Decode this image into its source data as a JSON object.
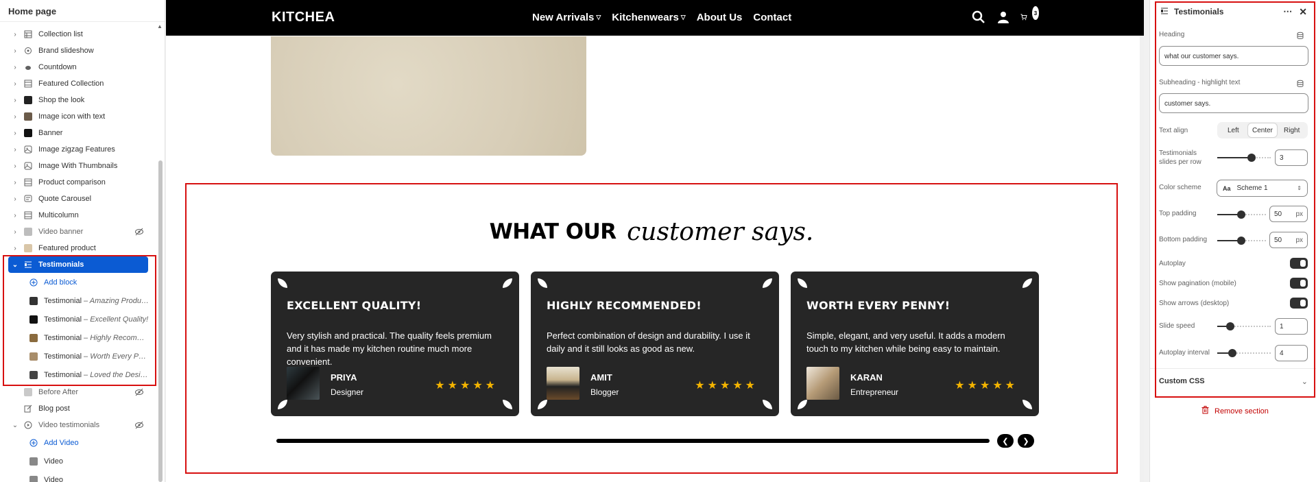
{
  "left_panel": {
    "title": "Home page",
    "items": [
      {
        "label": "Collection list",
        "icon": "grid-icon"
      },
      {
        "label": "Brand slideshow",
        "icon": "slideshow-icon"
      },
      {
        "label": "Countdown",
        "icon": "timer-icon"
      },
      {
        "label": "Featured Collection",
        "icon": "grid-icon"
      },
      {
        "label": "Shop the look",
        "icon": "image-thumb"
      },
      {
        "label": "Image icon with text",
        "icon": "image-thumb"
      },
      {
        "label": "Banner",
        "icon": "image-thumb"
      },
      {
        "label": "Image zigzag Features",
        "icon": "image-icon"
      },
      {
        "label": "Image With Thumbnails",
        "icon": "image-icon"
      },
      {
        "label": "Product comparison",
        "icon": "grid-icon"
      },
      {
        "label": "Quote Carousel",
        "icon": "quote-icon"
      },
      {
        "label": "Multicolumn",
        "icon": "grid-icon"
      },
      {
        "label": "Video banner",
        "icon": "image-thumb",
        "hidden": true
      },
      {
        "label": "Featured product",
        "icon": "image-thumb"
      }
    ],
    "selected": {
      "label": "Testimonials"
    },
    "add_block": "Add block",
    "blocks": [
      {
        "label": "Testimonial",
        "sub": "– Amazing Product!"
      },
      {
        "label": "Testimonial",
        "sub": "– Excellent Quality!"
      },
      {
        "label": "Testimonial",
        "sub": "– Highly Recomme..."
      },
      {
        "label": "Testimonial",
        "sub": "– Worth Every Pen..."
      },
      {
        "label": "Testimonial",
        "sub": "– Loved the Design!"
      }
    ],
    "after": [
      {
        "label": "Before After",
        "hidden": true
      },
      {
        "label": "Blog post"
      },
      {
        "label": "Video testimonials",
        "hidden": true
      }
    ],
    "add_video": "Add Video",
    "videos": [
      "Video",
      "Video"
    ]
  },
  "store": {
    "logo": "KITCHEA",
    "nav": [
      {
        "label": "New Arrivals",
        "has_caret": true
      },
      {
        "label": "Kitchenwears",
        "has_caret": true
      },
      {
        "label": "About Us"
      },
      {
        "label": "Contact"
      }
    ],
    "cart_count": "3",
    "section_heading": {
      "plain": "WHAT OUR",
      "script": "customer says."
    },
    "testimonials": [
      {
        "title": "EXCELLENT QUALITY!",
        "text": "Very stylish and practical. The quality feels premium and it has made my kitchen routine much more convenient.",
        "name": "PRIYA",
        "role": "Designer",
        "rating": 5
      },
      {
        "title": "HIGHLY RECOMMENDED!",
        "text": "Perfect combination of design and durability. I use it daily and it still looks as good as new.",
        "name": "AMIT",
        "role": "Blogger",
        "rating": 5
      },
      {
        "title": "WORTH EVERY PENNY!",
        "text": "Simple, elegant, and very useful. It adds a modern touch to my kitchen while being easy to maintain.",
        "name": "KARAN",
        "role": "Entrepreneur",
        "rating": 5
      }
    ],
    "stars": "★★★★★"
  },
  "settings": {
    "title": "Testimonials",
    "heading_label": "Heading",
    "heading_value": "what our customer says.",
    "subheading_label": "Subheading - highlight text",
    "subheading_value": "customer says.",
    "text_align_label": "Text align",
    "text_align_options": [
      "Left",
      "Center",
      "Right"
    ],
    "text_align_selected": "Center",
    "slides_label_1": "Testimonials",
    "slides_label_2": "slides per row",
    "slides_value": "3",
    "color_scheme_label": "Color scheme",
    "color_scheme_value": "Scheme 1",
    "top_padding_label": "Top padding",
    "top_padding_value": "50",
    "bottom_padding_label": "Bottom padding",
    "bottom_padding_value": "50",
    "unit": "px",
    "autoplay_label": "Autoplay",
    "pagination_label": "Show pagination (mobile)",
    "arrows_label": "Show arrows (desktop)",
    "slide_speed_label": "Slide speed",
    "slide_speed_value": "1",
    "autoplay_interval_label": "Autoplay interval",
    "autoplay_interval_value": "4",
    "custom_css_label": "Custom CSS",
    "remove_label": "Remove section"
  },
  "colors": {
    "accent": "#0b5bd3",
    "highlight_border": "#d70f0f",
    "card_bg": "#262626",
    "star": "#f4b400",
    "danger": "#c20000"
  }
}
